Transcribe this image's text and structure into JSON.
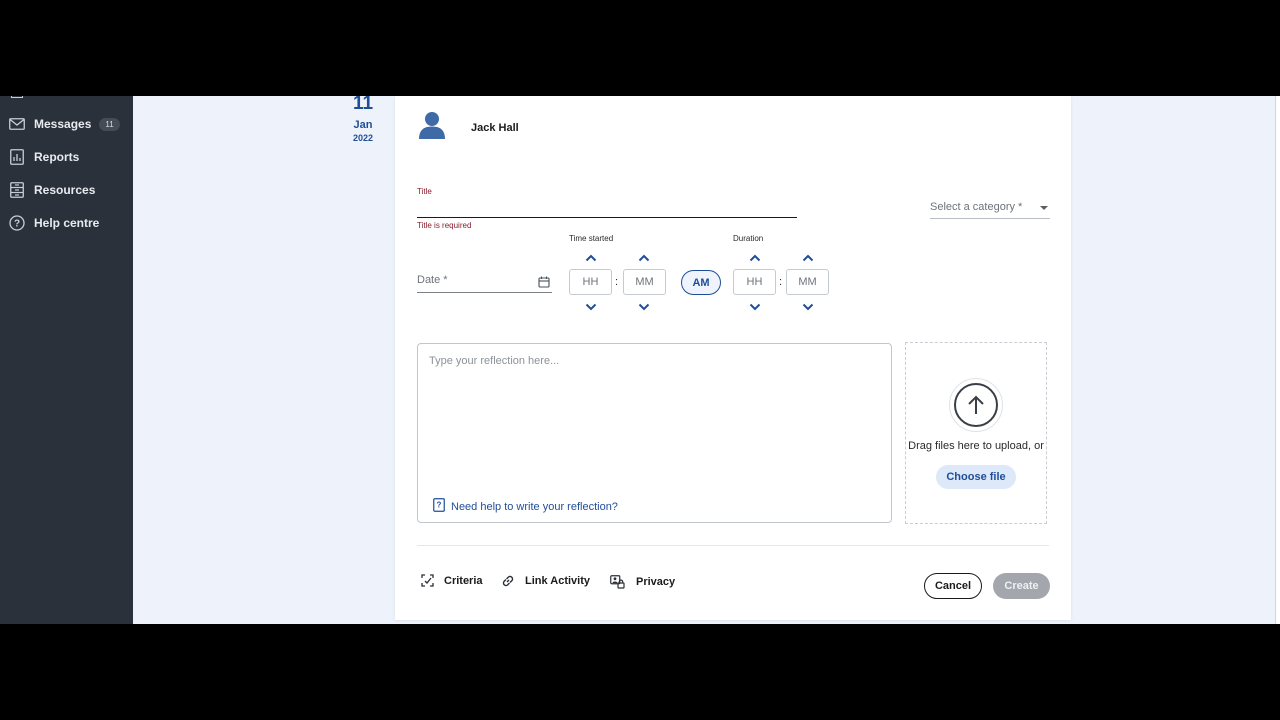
{
  "sidebar": {
    "items": [
      {
        "label": "Messages",
        "icon": "mail-icon",
        "badge": "11"
      },
      {
        "label": "Reports",
        "icon": "report-icon"
      },
      {
        "label": "Resources",
        "icon": "resources-icon"
      },
      {
        "label": "Help centre",
        "icon": "help-icon"
      }
    ]
  },
  "entry_date": {
    "day": "11",
    "month": "Jan",
    "year": "2022"
  },
  "user": {
    "name": "Jack Hall",
    "icon": "user-avatar-icon"
  },
  "form": {
    "title_label": "Title",
    "title_value": "",
    "title_error": "Title is required",
    "category_placeholder": "Select a category *",
    "date_placeholder": "Date *",
    "time_started_label": "Time started",
    "duration_label": "Duration",
    "hh_placeholder": "HH",
    "mm_placeholder": "MM",
    "colon": ":",
    "am_pm": "AM",
    "reflection_placeholder": "Type your reflection here...",
    "help_link": "Need help to write your reflection?"
  },
  "upload": {
    "drag_text": "Drag files here to upload, or",
    "choose_label": "Choose file"
  },
  "footer": {
    "criteria": "Criteria",
    "link_activity": "Link Activity",
    "privacy": "Privacy",
    "cancel": "Cancel",
    "create": "Create"
  },
  "colors": {
    "sidebar_bg": "#2b313a",
    "accent": "#1f4e98",
    "error": "#8a1c2b",
    "page_bg": "#edf2fb",
    "disabled_button": "#a3a7ad"
  }
}
